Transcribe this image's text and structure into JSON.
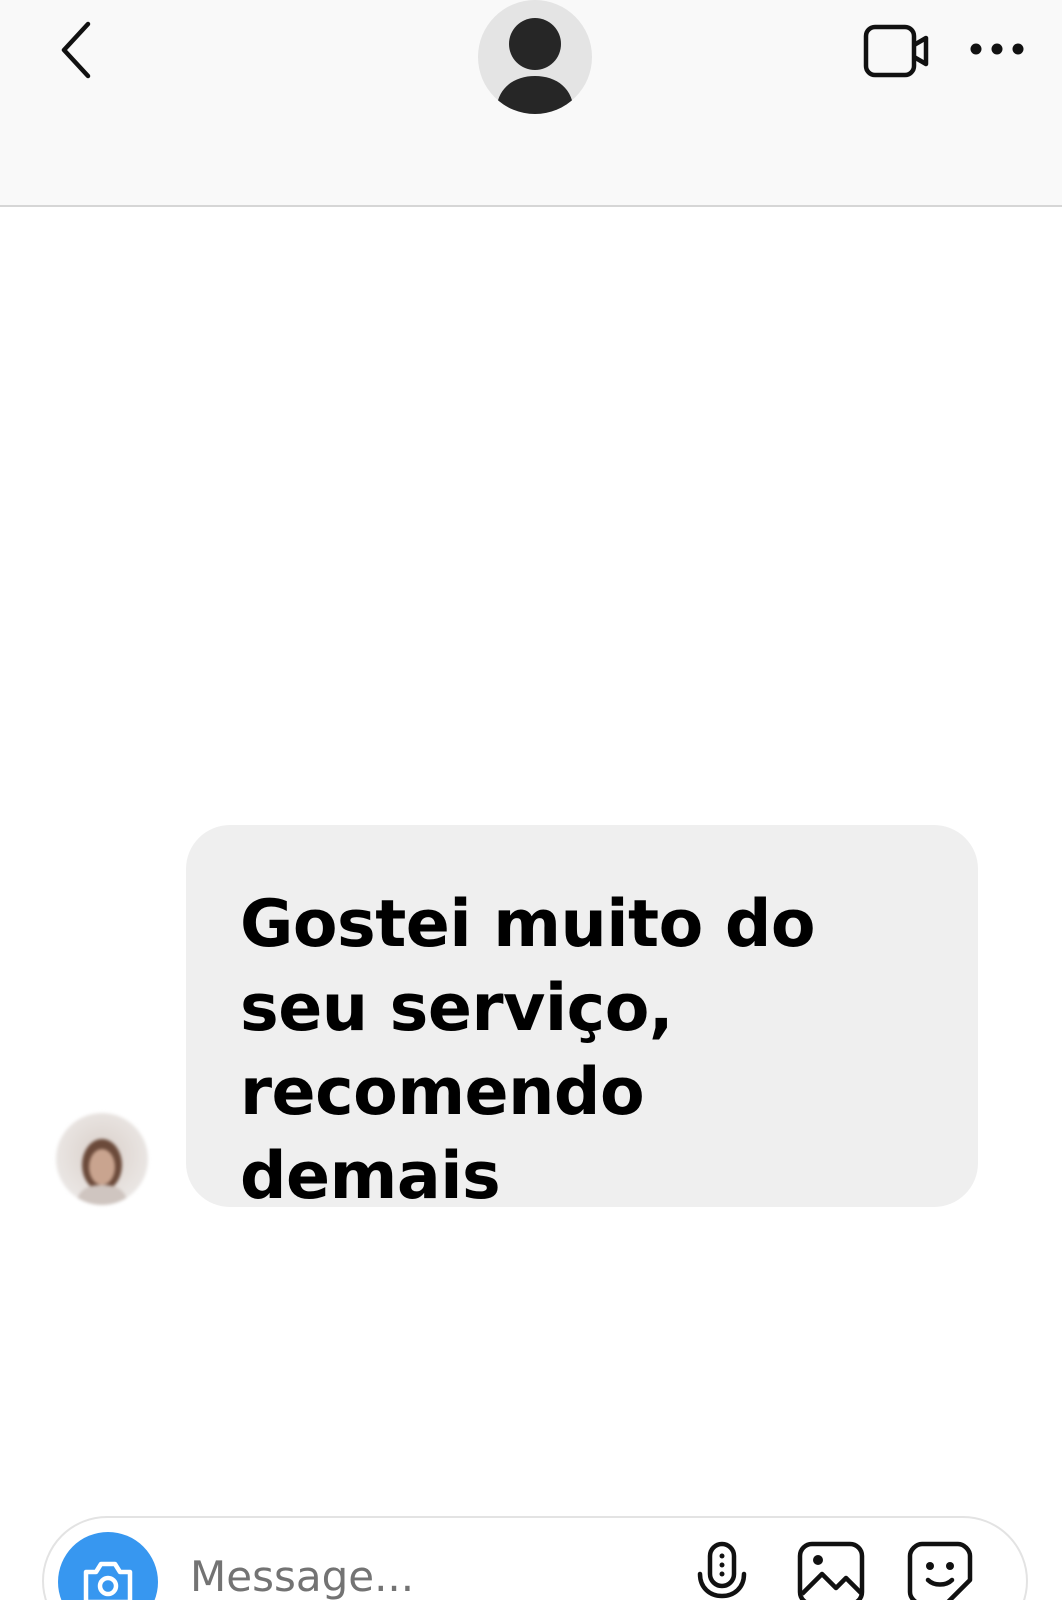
{
  "header": {
    "back_icon": "chevron-left-icon",
    "avatar_icon": "default-profile-icon",
    "video_icon": "video-call-icon",
    "more_icon": "more-horizontal-icon"
  },
  "thread": {
    "messages": [
      {
        "direction": "incoming",
        "text": "Gostei muito do seu serviço, recomendo demais"
      }
    ]
  },
  "composer": {
    "placeholder": "Message...",
    "camera_icon": "camera-icon",
    "mic_icon": "microphone-icon",
    "gallery_icon": "image-icon",
    "sticker_icon": "sticker-icon"
  },
  "colors": {
    "header_bg": "#f9f9f9",
    "bubble_bg": "#efefef",
    "accent": "#3797f0",
    "text": "#000000"
  }
}
